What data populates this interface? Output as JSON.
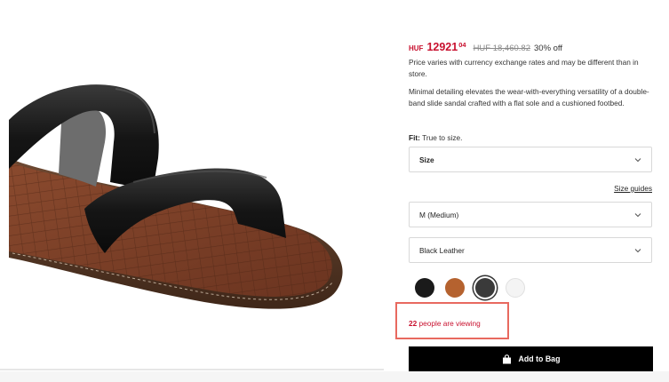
{
  "product": {
    "image_alt": "Black leather double-band slide sandal",
    "price": {
      "currency": "HUF",
      "amount": "12921",
      "cents": "04",
      "original": "HUF 18,460.82",
      "discount": "30% off"
    },
    "currency_note": "Price varies with currency exchange rates and may be different than in store.",
    "description": "Minimal detailing elevates the wear-with-everything versatility of a double-band slide sandal crafted with a flat sole and a cushioned footbed.",
    "fit": {
      "label": "Fit:",
      "value": "True to size."
    },
    "size_select": {
      "value": "Size"
    },
    "size_guides_label": "Size guides",
    "width_select": {
      "value": "M (Medium)"
    },
    "color_select": {
      "value": "Black Leather"
    },
    "swatches": [
      {
        "name": "black",
        "color": "#1a1a1a",
        "selected": false
      },
      {
        "name": "cognac",
        "color": "#b5622f",
        "selected": false
      },
      {
        "name": "dark-gray",
        "color": "#3a3a3a",
        "selected": true
      },
      {
        "name": "white",
        "color": "#f4f4f4",
        "selected": false
      }
    ],
    "viewing": {
      "count": "22",
      "text": "people are viewing"
    },
    "add_to_bag_label": "Add to Bag"
  },
  "colors": {
    "accent_red": "#c8102e",
    "highlight_border": "#e8695f",
    "button_bg": "#000000"
  }
}
